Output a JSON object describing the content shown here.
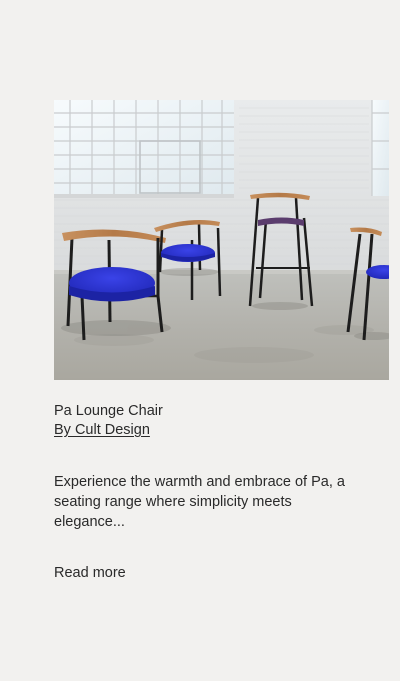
{
  "product": {
    "image_alt": "Pa Lounge Chair",
    "title": "Pa Lounge Chair",
    "brand": "By Cult Design",
    "description": "Experience the warmth and embrace of Pa, a seating range where simplicity meets elegance...",
    "read_more_label": "Read more"
  },
  "colors": {
    "background": "#f2f1ef",
    "text": "#2a2a2a",
    "seat_blue": "#2b33d6",
    "wood": "#b77d4c",
    "frame": "#1d1d1d",
    "stool_seat": "#5b3d6e"
  }
}
